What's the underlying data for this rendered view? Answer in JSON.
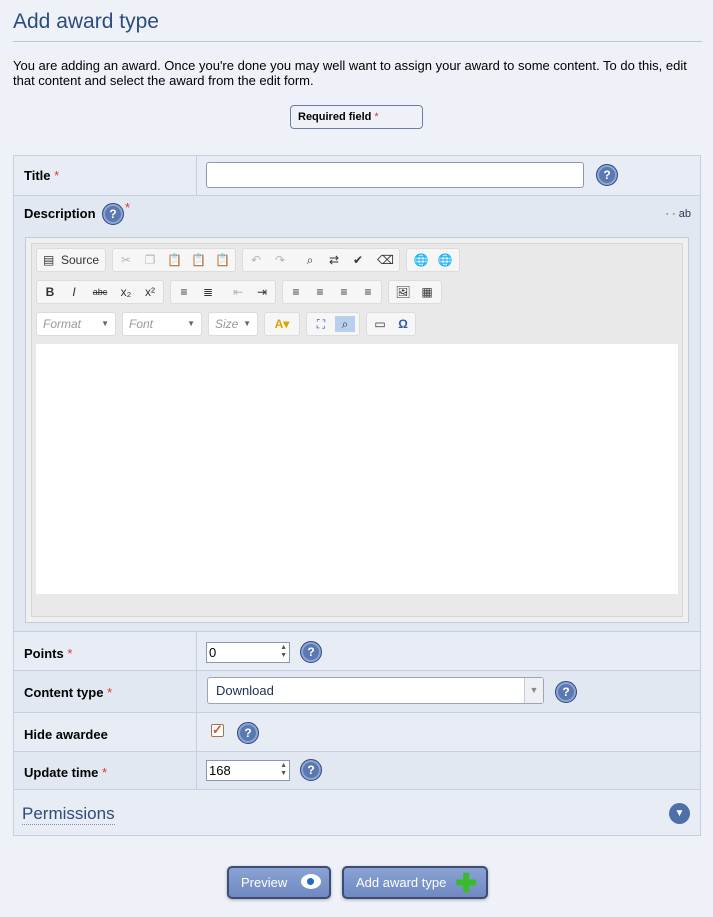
{
  "page": {
    "title": "Add award type",
    "intro": "You are adding an award. Once you're done you may well want to assign your award to some content. To do this, edit that content and select the award from the edit form.",
    "required_label": "Required field",
    "required_star": "*"
  },
  "form": {
    "title_label": "Title",
    "title_value": "",
    "description_label": "Description",
    "points_label": "Points",
    "points_value": "0",
    "content_type_label": "Content type",
    "content_type_value": "Download",
    "hide_awardee_label": "Hide awardee",
    "hide_awardee_checked": true,
    "update_time_label": "Update time",
    "update_time_value": "168",
    "help_glyph": "?",
    "star": "*"
  },
  "editor": {
    "source_label": "Source",
    "format_placeholder": "Format",
    "font_placeholder": "Font",
    "size_placeholder": "Size",
    "description_toolbar_icons": "· · ab"
  },
  "permissions": {
    "label": "Permissions"
  },
  "buttons": {
    "preview": "Preview",
    "add": "Add award type"
  }
}
